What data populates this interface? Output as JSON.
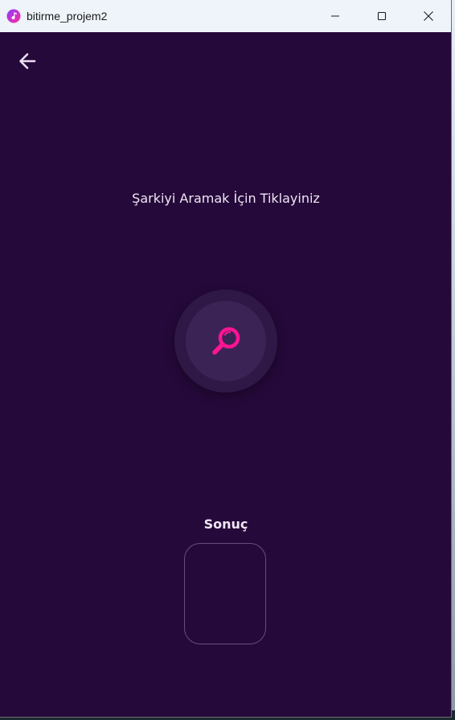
{
  "window": {
    "title": "bitirme_projem2",
    "controls": [
      "minimize",
      "maximize",
      "close"
    ]
  },
  "icons": {
    "app": "app-music-icon",
    "back": "arrow-left-icon",
    "search": "magnifier-icon"
  },
  "main": {
    "prompt": "Şarkiyi Aramak İçin Tiklayiniz",
    "result_label": "Sonuç"
  },
  "colors": {
    "background": "#25093a",
    "accent": "#ff1493",
    "search_button": "#3b2356",
    "text": "#efe6f4"
  }
}
